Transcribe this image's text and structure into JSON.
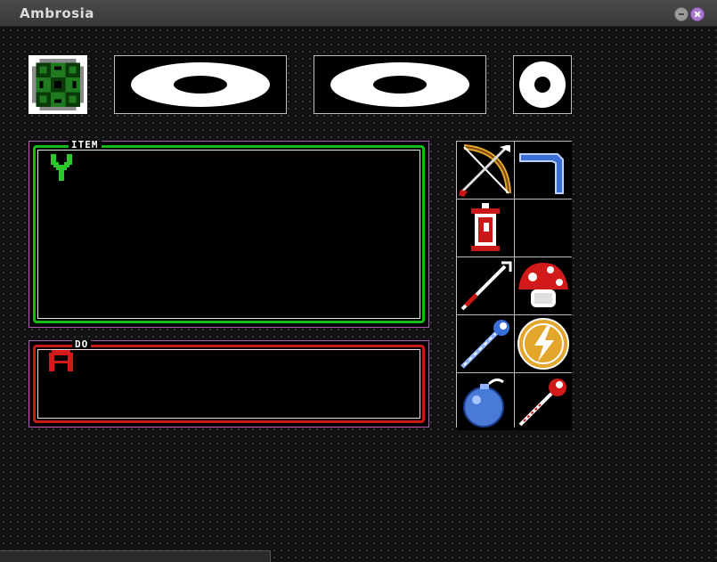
{
  "window": {
    "title": "Ambrosia"
  },
  "equipment": {
    "compass": {
      "icon": "compass-clover-icon"
    },
    "slots": [
      {
        "icon": "wide-oval-ring-icon"
      },
      {
        "icon": "wide-oval-ring-icon"
      },
      {
        "icon": "ring-icon"
      }
    ]
  },
  "item_panel": {
    "label": "ITEM",
    "selected_icon": "slingshot-icon",
    "accent_color": "#18b818"
  },
  "do_panel": {
    "label": "DO",
    "selected_icon": "a-button-icon",
    "accent_color": "#c81818"
  },
  "inventory": {
    "items": [
      {
        "icon": "bow-and-arrow-icon"
      },
      {
        "icon": "boomerang-icon"
      },
      {
        "icon": "lantern-icon"
      },
      {
        "icon": "empty-slot"
      },
      {
        "icon": "fire-rod-icon"
      },
      {
        "icon": "mushroom-icon"
      },
      {
        "icon": "ice-rod-icon"
      },
      {
        "icon": "lightning-medallion-icon"
      },
      {
        "icon": "bomb-icon"
      },
      {
        "icon": "fire-wand-icon"
      }
    ]
  }
}
